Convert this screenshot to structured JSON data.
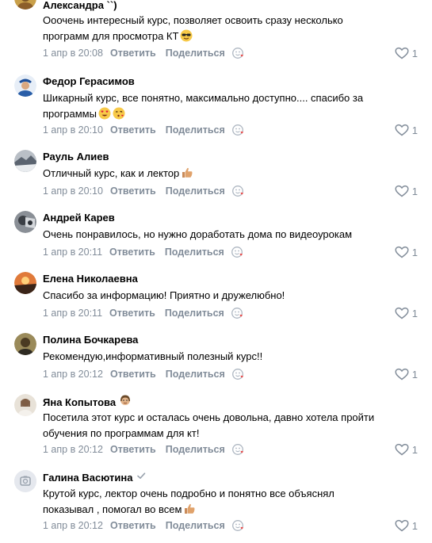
{
  "actions": {
    "reply_label": "Ответить",
    "share_label": "Поделиться"
  },
  "colors": {
    "meta": "#818c99",
    "heart": "#e64646",
    "background": "#ffffff"
  },
  "comments": [
    {
      "author": "Александра ``)",
      "text": "Ооочень интересный курс, позволяет освоить сразу несколько программ для просмотра КТ",
      "text_lines": [
        "Ооочень интересный курс, позволяет освоить сразу несколько",
        "программ для просмотра КТ"
      ],
      "emoji": [
        "sunglasses-emoji"
      ],
      "date": "1 апр в 20:08",
      "likes": "1",
      "avatar": "photo-avatar-golden"
    },
    {
      "author": "Федор Герасимов",
      "text": "Шикарный курс, все понятно, максимально доступно.... спасибо за программы",
      "text_lines": [
        "Шикарный курс, все понятно, максимально доступно.... спасибо за",
        "программы"
      ],
      "emoji": [
        "heart-eyes-emoji",
        "kissing-heart-emoji"
      ],
      "date": "1 апр в 20:10",
      "likes": "1",
      "avatar": "photo-avatar-blue"
    },
    {
      "author": "Рауль Алиев",
      "text": "Отличный курс, как и лектор",
      "text_lines": [
        "Отличный курс, как и лектор"
      ],
      "emoji": [
        "thumbs-up-emoji"
      ],
      "date": "1 апр в 20:10",
      "likes": "1",
      "avatar": "photo-avatar-grey"
    },
    {
      "author": "Андрей Карев",
      "text": "Очень понравилось, но нужно доработать дома по видеоурокам",
      "text_lines": [
        "Очень понравилось, но нужно доработать дома по видеоурокам"
      ],
      "emoji": [],
      "date": "1 апр в 20:11",
      "likes": "1",
      "avatar": "photo-avatar-dark"
    },
    {
      "author": "Елена Николаевна",
      "text": "Спасибо за информацию! Приятно и дружелюбно!",
      "text_lines": [
        "Спасибо за информацию! Приятно и дружелюбно!"
      ],
      "emoji": [],
      "date": "1 апр в 20:11",
      "likes": "1",
      "avatar": "photo-avatar-sunset"
    },
    {
      "author": "Полина Бочкарева",
      "text": "Рекомендую,информативный полезный курс!!",
      "text_lines": [
        "Рекомендую,информативный полезный курс!!"
      ],
      "emoji": [],
      "date": "1 апр в 20:12",
      "likes": "1",
      "avatar": "photo-avatar-olive"
    },
    {
      "author": "Яна Копытова",
      "text": "Посетила этот курс и осталась очень довольна, давно хотела пройти обучения по программам для кт!",
      "text_lines": [
        "Посетила этот курс и осталась очень довольна, давно хотела пройти",
        "обучения по программам для кт!"
      ],
      "emoji": [],
      "author_badge": "woman-emoji",
      "date": "1 апр в 20:12",
      "likes": "1",
      "avatar": "photo-avatar-light"
    },
    {
      "author": "Галина Васютина",
      "text": "Крутой курс, лектор очень подробно и понятно все объяснял показывал , помогал во всем",
      "text_lines": [
        "Крутой курс, лектор очень подробно и понятно все объяснял",
        "показывал , помогал во всем"
      ],
      "emoji": [
        "thumbs-up-emoji"
      ],
      "author_badge": "verified-check-icon",
      "date": "1 апр в 20:12",
      "likes": "1",
      "avatar": "placeholder-avatar"
    }
  ]
}
